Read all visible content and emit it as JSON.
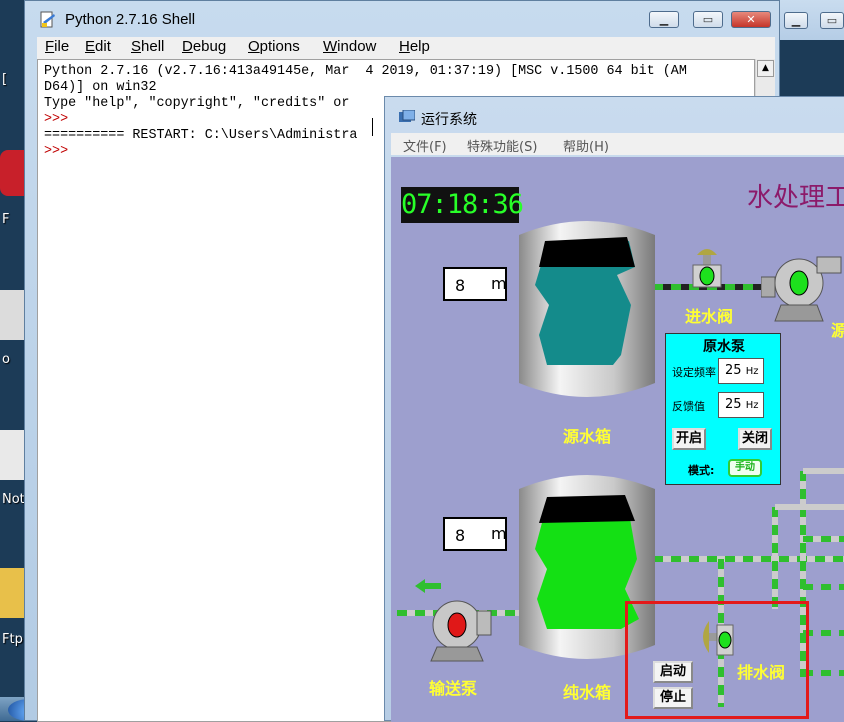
{
  "desktop": {
    "icon_labels": [
      "[",
      "F",
      "o",
      "Not",
      "Ftp"
    ]
  },
  "shell": {
    "title": "Python 2.7.16 Shell",
    "menu": [
      "File",
      "Edit",
      "Shell",
      "Debug",
      "Options",
      "Window",
      "Help"
    ],
    "lines": [
      "Python 2.7.16 (v2.7.16:413a49145e, Mar  4 2019, 01:37:19) [MSC v.1500 64 bit (AM",
      "D64)] on win32",
      "Type \"help\", \"copyright\", \"credits\" or",
      ">>> ",
      "========== RESTART: C:\\Users\\Administra",
      ">>> "
    ],
    "scroll_up": "▲"
  },
  "run_window": {
    "title": "运行系统",
    "menu": [
      "文件(F)",
      "特殊功能(S)",
      "帮助(H)"
    ]
  },
  "scada": {
    "clock": "07:18:36",
    "title": "水处理工",
    "source_tank": {
      "level": "8",
      "unit": "m",
      "label": "源水箱"
    },
    "pure_tank": {
      "level": "8",
      "unit": "m",
      "label": "纯水箱"
    },
    "inlet_valve_label": "进水阀",
    "pump_partial_label": "源",
    "drain_valve_label": "排水阀",
    "transfer_pump_label": "输送泵",
    "raw_pump_panel": {
      "title": "原水泵",
      "set_freq_label": "设定频率",
      "set_freq_value": "25",
      "feedback_label": "反馈值",
      "feedback_value": "25",
      "unit": "Hz",
      "start_label": "开启",
      "stop_label": "关闭",
      "mode_label": "模式:",
      "mode_value": "手动"
    },
    "drain_start_label": "启动",
    "drain_stop_label": "停止",
    "colors": {
      "bg": "#9d9fce",
      "label_yellow": "#ffff33",
      "clock_green": "#28ff28",
      "highlight": "#e31a1a"
    }
  }
}
